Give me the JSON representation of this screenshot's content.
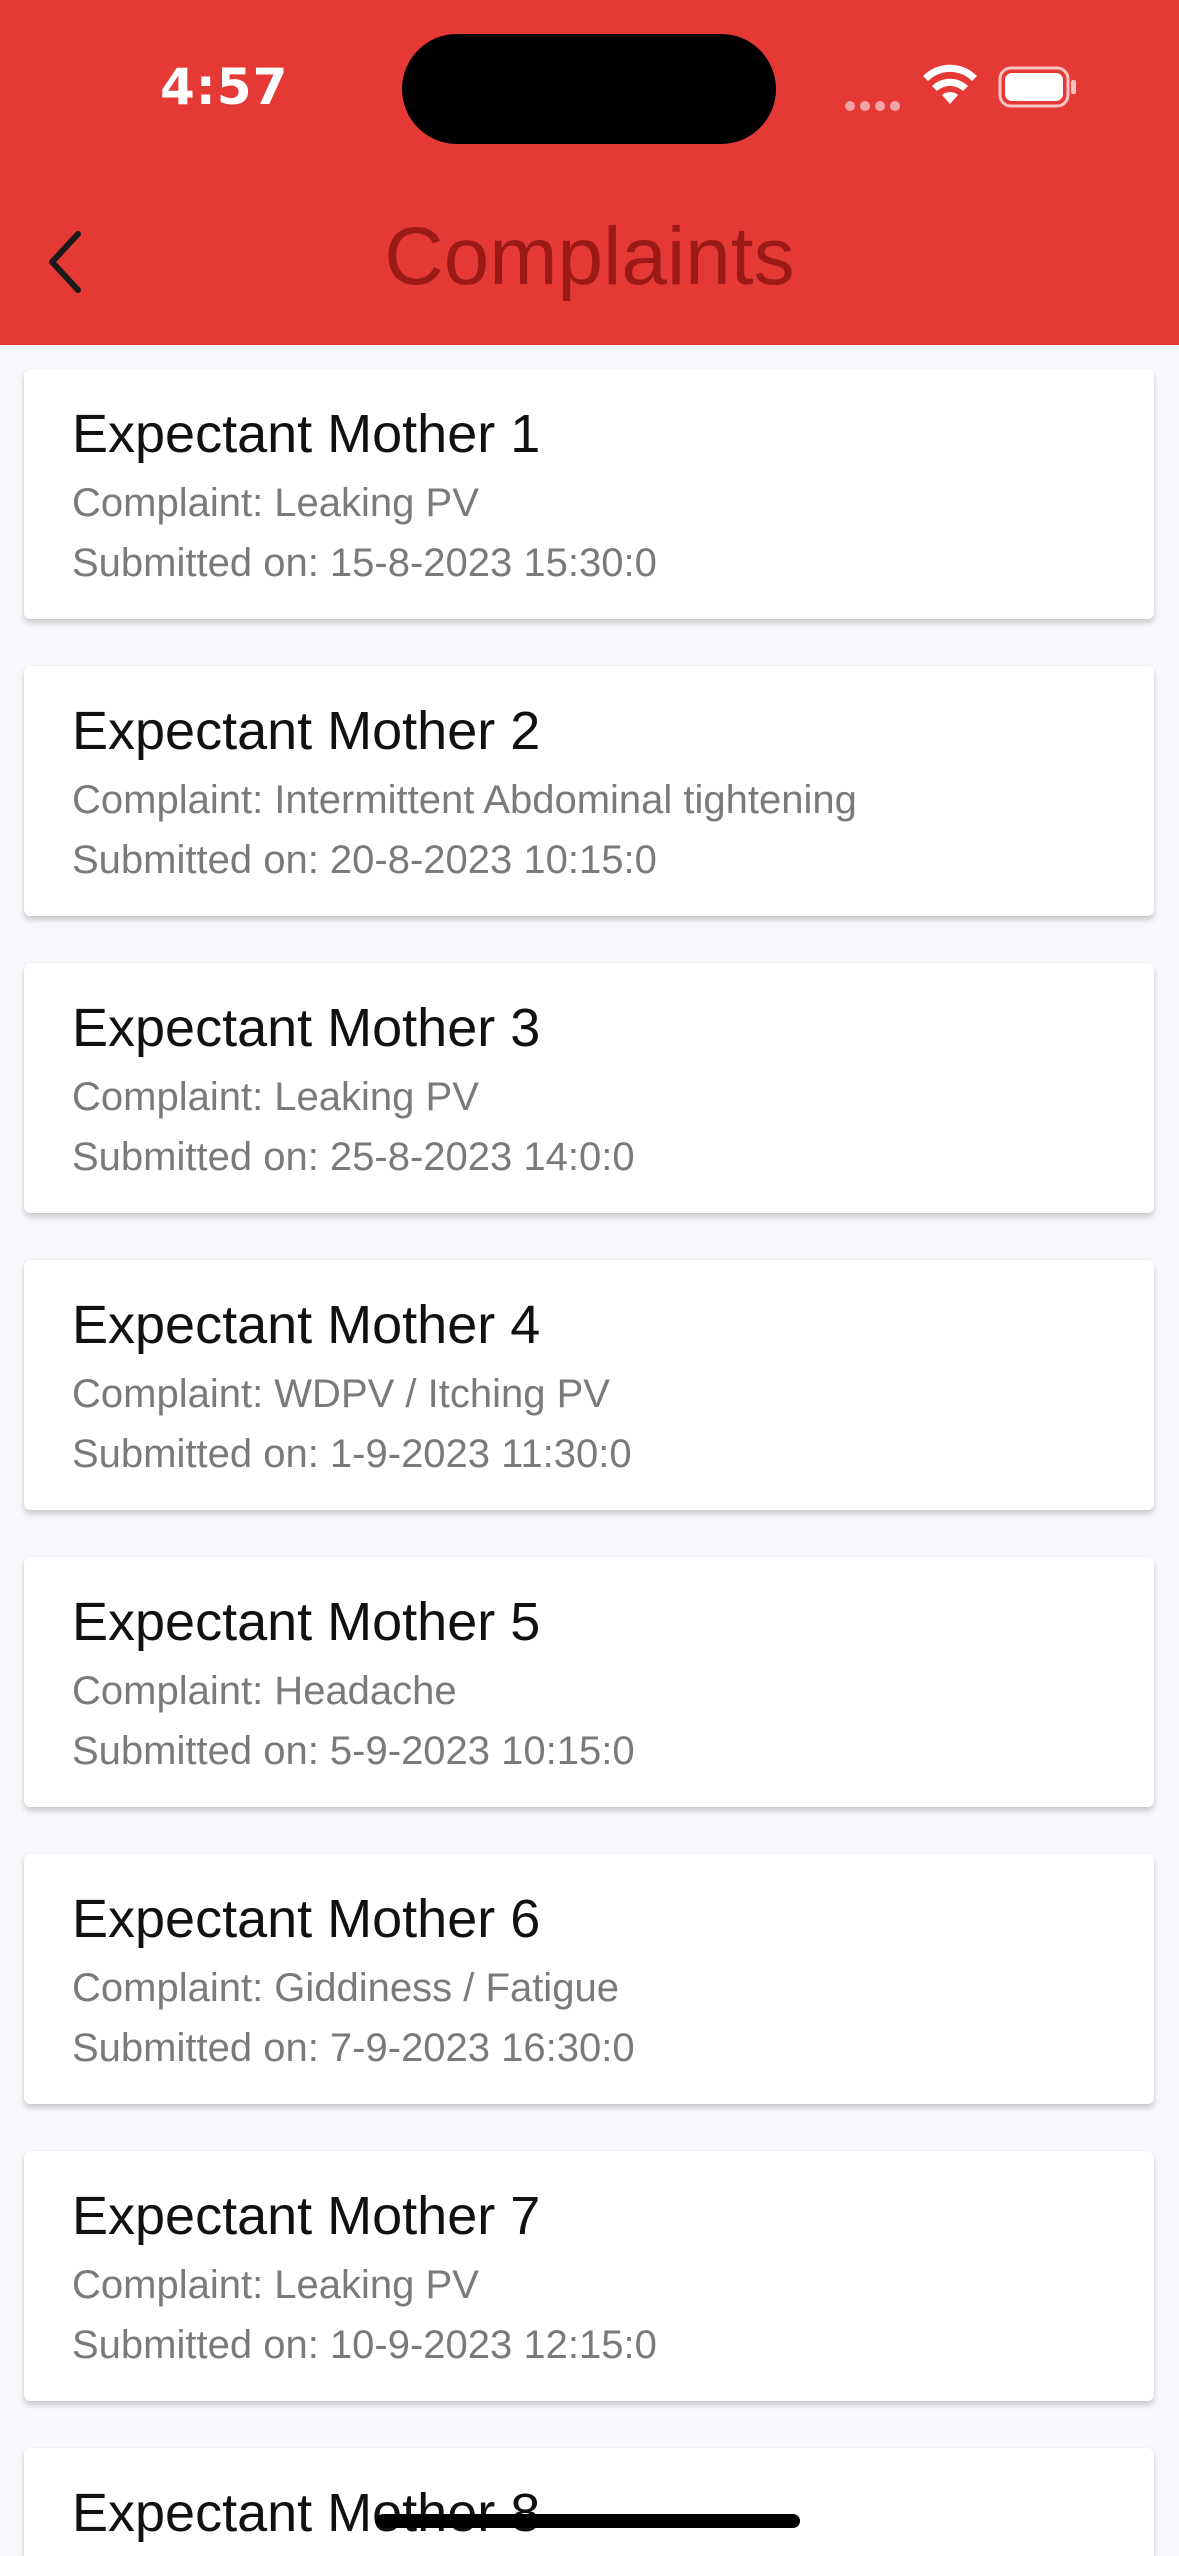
{
  "status_bar": {
    "time": "4:57"
  },
  "header": {
    "title": "Complaints",
    "back_icon": "chevron-left-icon",
    "background_color": "#e53935",
    "title_color": "#9b1a16"
  },
  "complaints": [
    {
      "name": "Expectant Mother 1",
      "complaint": "Complaint: Leaking PV",
      "submitted": "Submitted on: 15-8-2023 15:30:0"
    },
    {
      "name": "Expectant Mother 2",
      "complaint": "Complaint: Intermittent Abdominal tightening",
      "submitted": "Submitted on: 20-8-2023 10:15:0"
    },
    {
      "name": "Expectant Mother 3",
      "complaint": "Complaint: Leaking PV",
      "submitted": "Submitted on: 25-8-2023 14:0:0"
    },
    {
      "name": "Expectant Mother 4",
      "complaint": "Complaint: WDPV / Itching PV",
      "submitted": "Submitted on: 1-9-2023 11:30:0"
    },
    {
      "name": "Expectant Mother 5",
      "complaint": "Complaint: Headache",
      "submitted": "Submitted on: 5-9-2023 10:15:0"
    },
    {
      "name": "Expectant Mother 6",
      "complaint": "Complaint: Giddiness / Fatigue",
      "submitted": "Submitted on: 7-9-2023 16:30:0"
    },
    {
      "name": "Expectant Mother 7",
      "complaint": "Complaint: Leaking PV",
      "submitted": "Submitted on: 10-9-2023 12:15:0"
    },
    {
      "name": "Expectant Mother 8",
      "complaint": "",
      "submitted": ""
    }
  ]
}
